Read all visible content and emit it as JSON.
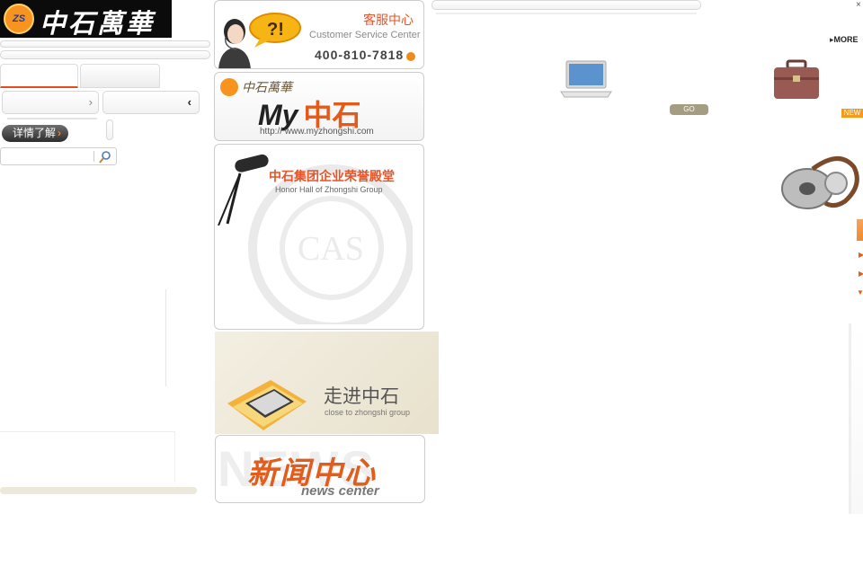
{
  "logo": {
    "emblem": "ZS",
    "name": "中石萬華"
  },
  "left": {
    "details_button": "详情了解",
    "details_arrow": "›",
    "search": {
      "placeholder": "",
      "icon": "search-icon"
    }
  },
  "customer_service": {
    "title": "客服中心",
    "subtitle": "Customer Service Center",
    "phone": "400-810-7818",
    "icon": "question-exclamation-bubble-icon"
  },
  "my_zhongshi": {
    "brand": "中石萬華",
    "title_latin": "My",
    "title_cn": "中石",
    "url": "http:// www.myzhongshi.com"
  },
  "honor_hall": {
    "title": "中石集团企业荣誉殿堂",
    "subtitle": "Honor Hall of Zhongshi Group",
    "seal_text": "CAS"
  },
  "enter": {
    "title": "走进中石",
    "subtitle": "close to zhongshi group"
  },
  "news": {
    "bg_text": "NEWS",
    "title": "新闻中心",
    "subtitle": "news center"
  },
  "right": {
    "more_label": "MORE",
    "go_label": "GO",
    "new_label": "NEW",
    "close_glyph": "×"
  }
}
